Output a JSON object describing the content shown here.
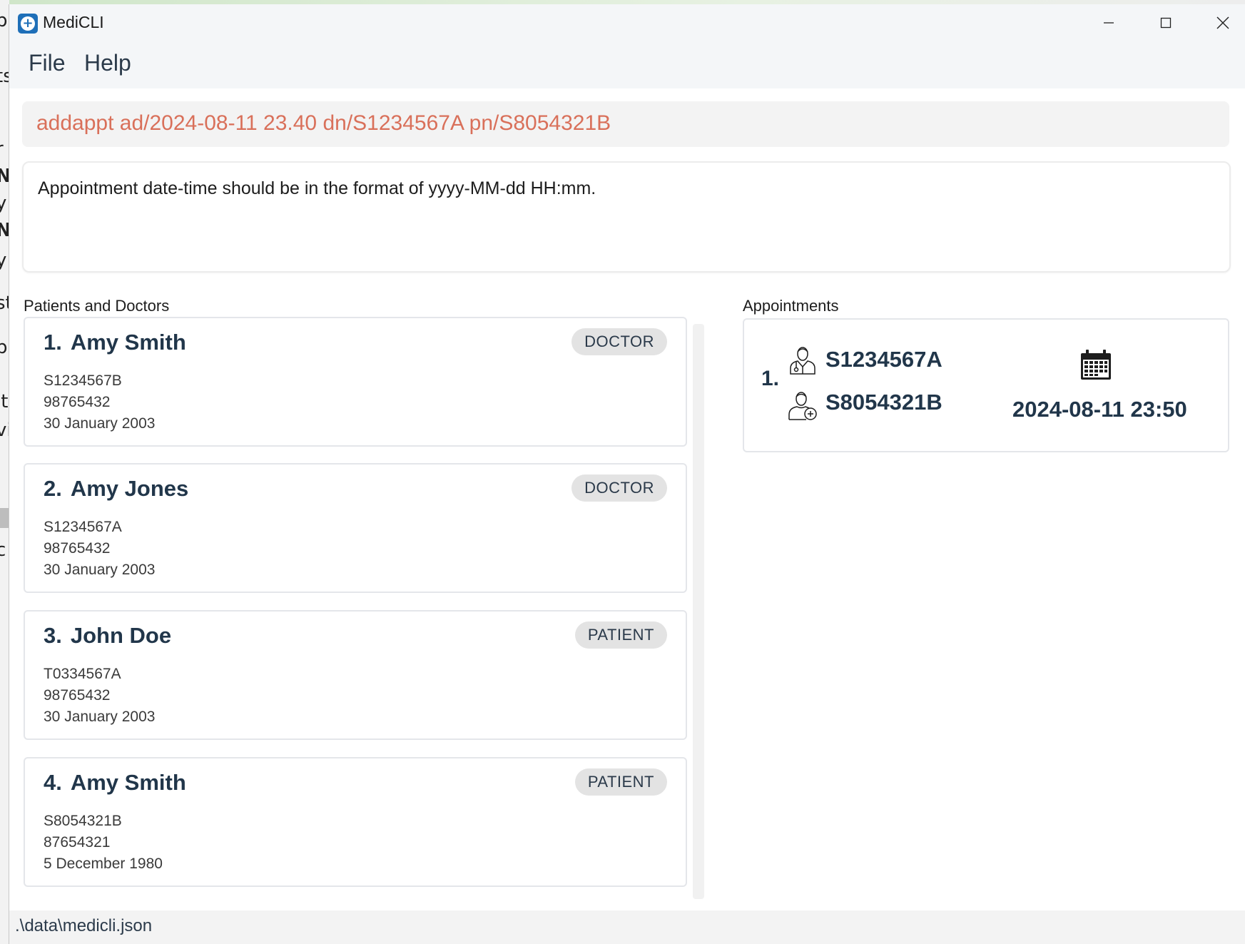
{
  "window": {
    "title": "MediCLI"
  },
  "menu": {
    "file": "File",
    "help": "Help"
  },
  "command": {
    "value": "addappt ad/2024-08-11 23.40 dn/S1234567A pn/S8054321B"
  },
  "result": {
    "message": "Appointment date-time should be in the format of yyyy-MM-dd HH:mm."
  },
  "people_panel": {
    "title": "Patients and Doctors",
    "items": [
      {
        "index": "1.",
        "name": "Amy Smith",
        "role": "DOCTOR",
        "nric": "S1234567B",
        "phone": "98765432",
        "dob": "30 January 2003"
      },
      {
        "index": "2.",
        "name": "Amy Jones",
        "role": "DOCTOR",
        "nric": "S1234567A",
        "phone": "98765432",
        "dob": "30 January 2003"
      },
      {
        "index": "3.",
        "name": "John Doe",
        "role": "PATIENT",
        "nric": "T0334567A",
        "phone": "98765432",
        "dob": "30 January 2003"
      },
      {
        "index": "4.",
        "name": "Amy Smith",
        "role": "PATIENT",
        "nric": "S8054321B",
        "phone": "87654321",
        "dob": "5 December 1980"
      }
    ]
  },
  "appointments_panel": {
    "title": "Appointments",
    "items": [
      {
        "index": "1.",
        "doctor_nric": "S1234567A",
        "patient_nric": "S8054321B",
        "datetime": "2024-08-11 23:50",
        "doctor_icon": "doctor-icon",
        "patient_icon": "patient-icon",
        "date_icon": "calendar-icon"
      }
    ]
  },
  "status": {
    "file_path": ".\\data\\medicli.json"
  },
  "colors": {
    "command_text": "#d9705a",
    "heading_text": "#21364a",
    "badge_bg": "#e3e3e3"
  }
}
